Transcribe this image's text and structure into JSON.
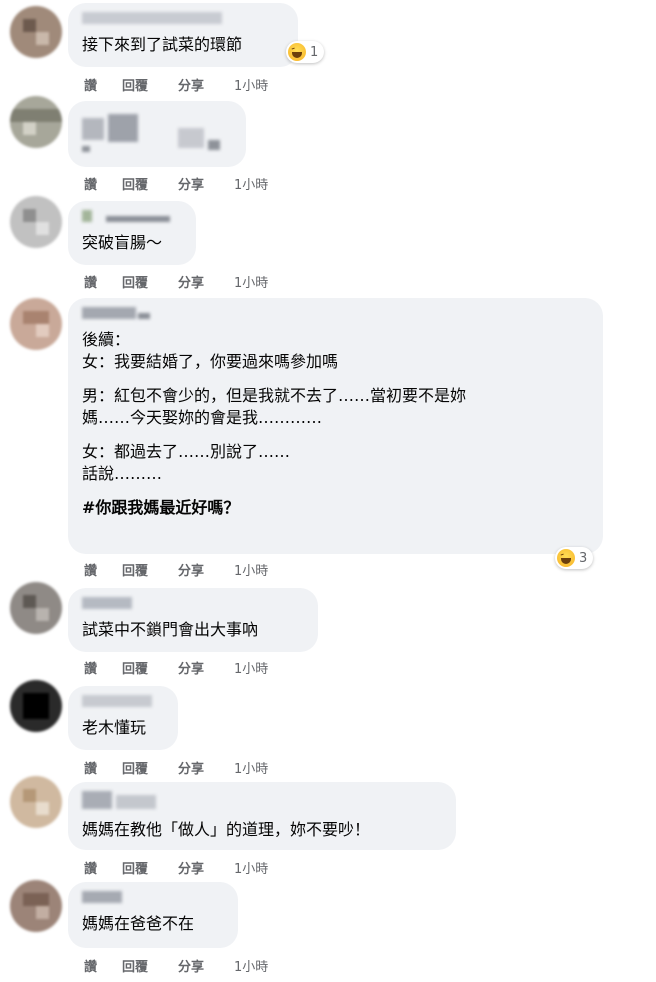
{
  "labels": {
    "like": "讚",
    "reply": "回覆",
    "share": "分享"
  },
  "comments": [
    {
      "lines": [
        "接下來到了試菜的環節"
      ],
      "reaction_count": "1",
      "time": "1小時"
    },
    {
      "lines": [
        ""
      ],
      "time": "1小時"
    },
    {
      "lines": [
        "突破盲腸～"
      ],
      "time": "1小時"
    },
    {
      "paragraphs": [
        [
          "後續：",
          "女：我要結婚了，你要過來嗎參加嗎"
        ],
        [
          "男：紅包不會少的，但是我就不去了……當初要不是妳",
          "媽……今天娶妳的會是我…………"
        ],
        [
          "女：都過去了……別說了……",
          "話說………"
        ],
        [
          "#你跟我媽最近好嗎？"
        ]
      ],
      "reaction_count": "3",
      "time": "1小時"
    },
    {
      "lines": [
        "試菜中不鎖門會出大事吶"
      ],
      "time": "1小時"
    },
    {
      "lines": [
        "老木懂玩"
      ],
      "time": "1小時"
    },
    {
      "lines": [
        "媽媽在教他「做人」的道理，妳不要吵！"
      ],
      "time": "1小時"
    },
    {
      "lines": [
        "媽媽在爸爸不在"
      ],
      "time": "1小時"
    }
  ],
  "colors": {
    "bubble": "#f0f2f5",
    "meta": "#65676b",
    "text": "#050505"
  },
  "icons": {
    "reaction": "haha-emoji-icon"
  }
}
